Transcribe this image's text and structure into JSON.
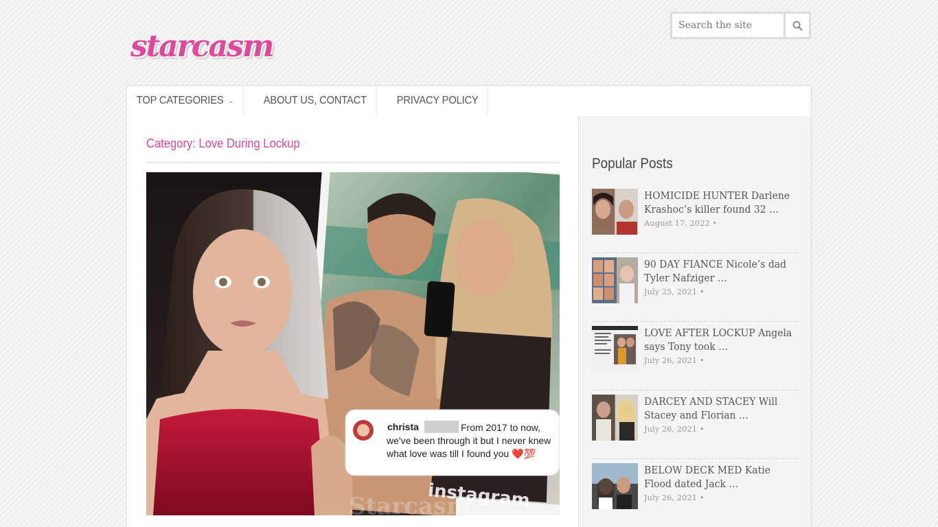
{
  "site": {
    "logo_text": "starcasm"
  },
  "search": {
    "placeholder": "Search the site"
  },
  "nav": {
    "items": [
      {
        "label": "TOP CATEGORIES"
      },
      {
        "label": "ABOUT US, CONTACT"
      },
      {
        "label": "PRIVACY POLICY"
      }
    ]
  },
  "main": {
    "category_title": "Category: Love During Lockup",
    "feature": {
      "caption_user": "christa",
      "caption_text": "From 2017 to now, we've been through it but I never knew what love was till I found you",
      "caption_emoji": "❤️💯",
      "watermark": "instagram",
      "watermark_site": "Starcasm"
    }
  },
  "sidebar": {
    "popular_title": "Popular Posts",
    "posts": [
      {
        "title": "HOMICIDE HUNTER Darlene Krashoc’s killer found 32 …",
        "date": "August 17, 2022 •"
      },
      {
        "title": "90 DAY FIANCE Nicole’s dad Tyler Nafziger …",
        "date": "July 25, 2021 •"
      },
      {
        "title": "LOVE AFTER LOCKUP Angela says Tony took …",
        "date": "July 26, 2021 •"
      },
      {
        "title": "DARCEY AND STACEY Will Stacey and Florian …",
        "date": "July 26, 2021 •"
      },
      {
        "title": "BELOW DECK MED Katie Flood dated Jack …",
        "date": "July 26, 2021 •"
      }
    ]
  },
  "colors": {
    "accent": "#e0489c",
    "text": "#555555",
    "muted": "#999999"
  }
}
